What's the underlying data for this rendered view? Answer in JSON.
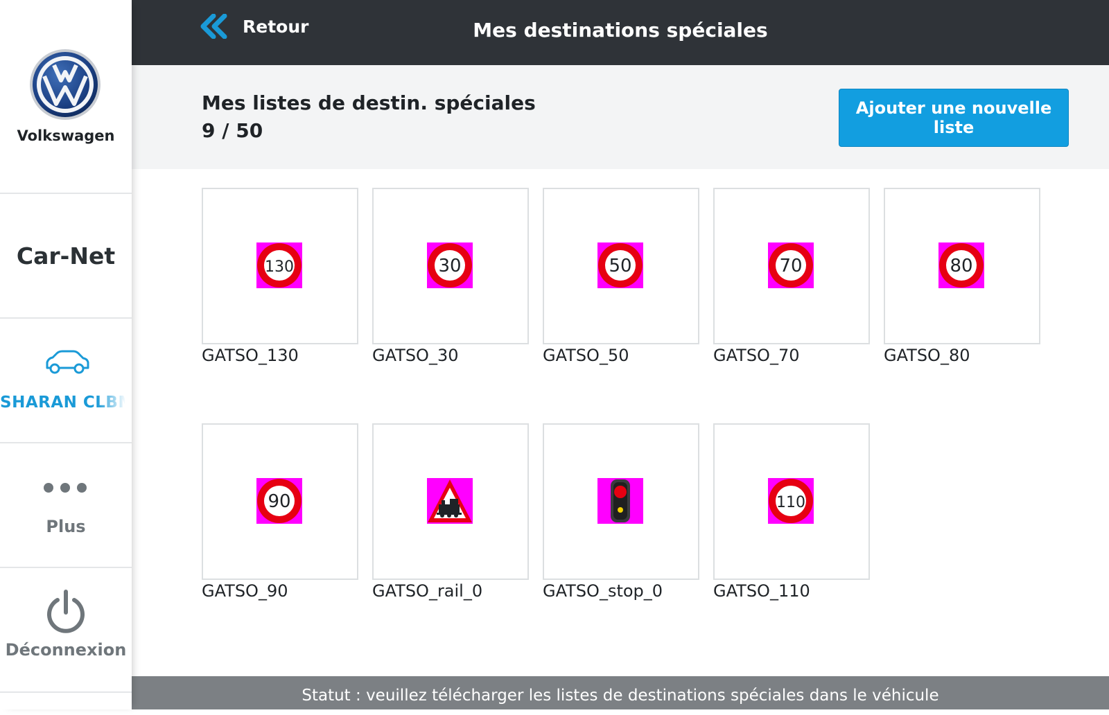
{
  "brand": {
    "name": "Volkswagen"
  },
  "sidebar": {
    "app_name": "Car-Net",
    "vehicle": {
      "label": "SHARAN CLBM"
    },
    "more": {
      "label": "Plus"
    },
    "logout": {
      "label": "Déconnexion"
    }
  },
  "header": {
    "back_label": "Retour",
    "title": "Mes destinations spéciales"
  },
  "subheader": {
    "title": "Mes listes de destin. spéciales",
    "count": "9 / 50",
    "add_button": "Ajouter une nouvelle liste"
  },
  "tiles": [
    {
      "label": "GATSO_130",
      "icon": "speed-limit-130-icon",
      "speed": "130"
    },
    {
      "label": "GATSO_30",
      "icon": "speed-limit-30-icon",
      "speed": "30"
    },
    {
      "label": "GATSO_50",
      "icon": "speed-limit-50-icon",
      "speed": "50"
    },
    {
      "label": "GATSO_70",
      "icon": "speed-limit-70-icon",
      "speed": "70"
    },
    {
      "label": "GATSO_80",
      "icon": "speed-limit-80-icon",
      "speed": "80"
    },
    {
      "label": "GATSO_90",
      "icon": "speed-limit-90-icon",
      "speed": "90"
    },
    {
      "label": "GATSO_rail_0",
      "icon": "railway-crossing-icon"
    },
    {
      "label": "GATSO_stop_0",
      "icon": "traffic-light-icon"
    },
    {
      "label": "GATSO_110",
      "icon": "speed-limit-110-icon",
      "speed": "110"
    }
  ],
  "status": {
    "text": "Statut : veuillez télécharger les listes de destinations spéciales dans le véhicule"
  },
  "colors": {
    "accent": "#129ee0",
    "header_bg": "#2f3338",
    "sign_bg": "#ff00ff",
    "sign_red": "#e60012"
  }
}
